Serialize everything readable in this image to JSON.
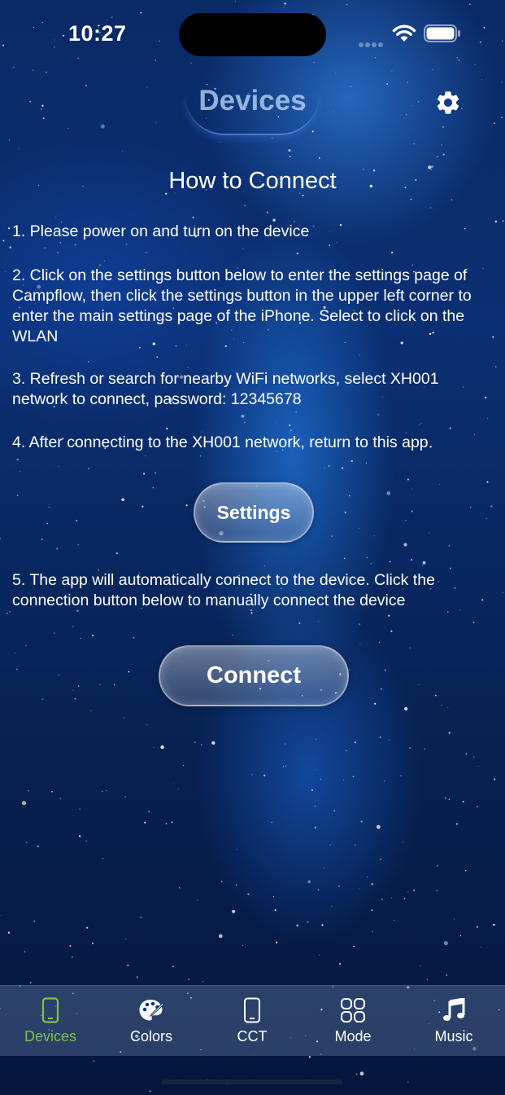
{
  "status_bar": {
    "time": "10:27"
  },
  "header": {
    "title": "Devices"
  },
  "content": {
    "heading": "How to Connect",
    "steps": [
      "1. Please power on and turn on the device",
      "2. Click on the settings button below to enter the settings page of Campflow, then click the settings button in the upper left corner to enter the main settings page of the iPhone. Select to click on the WLAN",
      "3. Refresh or search for nearby WiFi networks, select XH001 network to connect, password: 12345678",
      "4. After connecting to the XH001 network, return to this app",
      "5. The app will automatically connect to the device. Click the connection button below to manually connect the device"
    ],
    "settings_button": "Settings",
    "connect_button": "Connect"
  },
  "tab_bar": {
    "tabs": [
      {
        "label": "Devices",
        "icon": "phone-outline-icon",
        "active": true
      },
      {
        "label": "Colors",
        "icon": "palette-icon",
        "active": false
      },
      {
        "label": "CCT",
        "icon": "phone-outline-icon",
        "active": false
      },
      {
        "label": "Mode",
        "icon": "four-circles-icon",
        "active": false
      },
      {
        "label": "Music",
        "icon": "music-note-icon",
        "active": false
      }
    ]
  },
  "colors": {
    "accent_active_tab": "#7ec248",
    "background_deep": "#04163d",
    "background_glow": "#288cff"
  }
}
